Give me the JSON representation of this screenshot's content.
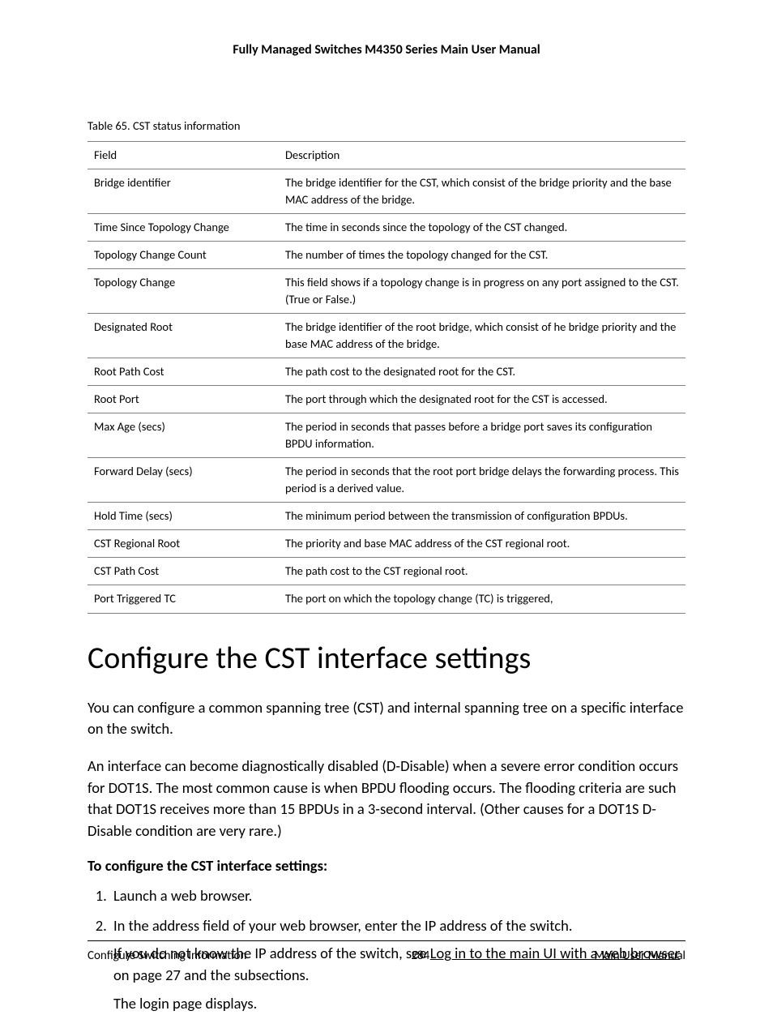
{
  "header": {
    "title": "Fully Managed Switches M4350 Series Main User Manual"
  },
  "table": {
    "caption": "Table 65. CST status information",
    "head": {
      "field": "Field",
      "desc": "Description"
    },
    "rows": [
      {
        "field": "Bridge identifier",
        "desc": "The bridge identifier for the CST, which consist of the bridge priority and the base MAC address of the bridge."
      },
      {
        "field": "Time Since Topology Change",
        "desc": "The time in seconds since the topology of the CST changed."
      },
      {
        "field": "Topology Change Count",
        "desc": "The number of times the topology changed for the CST."
      },
      {
        "field": "Topology Change",
        "desc": "This field shows if a topology change is in progress on any port assigned to the CST. (True or False.)"
      },
      {
        "field": "Designated Root",
        "desc": "The bridge identifier of the root bridge, which consist of he bridge priority and the base MAC address of the bridge."
      },
      {
        "field": "Root Path Cost",
        "desc": "The path cost to the designated root for the CST."
      },
      {
        "field": "Root Port",
        "desc": "The port through which the designated root for the CST is accessed."
      },
      {
        "field": "Max Age (secs)",
        "desc": "The period in seconds that passes before a bridge port saves its configuration BPDU information."
      },
      {
        "field": "Forward Delay (secs)",
        "desc": "The period in seconds that the root port bridge delays the forwarding process. This period is a derived value."
      },
      {
        "field": "Hold Time (secs)",
        "desc": "The minimum period between the transmission of configuration BPDUs."
      },
      {
        "field": "CST Regional Root",
        "desc": "The priority and base MAC address of the CST regional root."
      },
      {
        "field": "CST Path Cost",
        "desc": "The path cost to the CST regional root."
      },
      {
        "field": "Port Triggered TC",
        "desc": "The port on which the topology change (TC) is triggered,"
      }
    ]
  },
  "section": {
    "heading": "Configure the CST interface settings",
    "para1": "You can configure a common spanning tree (CST) and internal spanning tree on a specific interface on the switch.",
    "para2": "An interface can become diagnostically disabled (D-Disable) when a severe error condition occurs for DOT1S. The most common cause is when BPDU flooding occurs. The flooding criteria are such that DOT1S receives more than 15 BPDUs in a 3-second interval. (Other causes for a DOT1S D-Disable condition are very rare.)",
    "subheading": "To configure the CST interface settings:",
    "steps": {
      "s1": "Launch a web browser.",
      "s2": "In the address field of your web browser, enter the IP address of the switch.",
      "s2note_pre": "If you do not know the IP address of the switch, see ",
      "s2note_link": "Log in to the main UI with a web browser",
      "s2note_post": " on page 27 and the subsections.",
      "s2note2": "The login page displays."
    }
  },
  "footer": {
    "left": "Configure Switching Information",
    "center": "284",
    "right": "Main User Manual"
  }
}
